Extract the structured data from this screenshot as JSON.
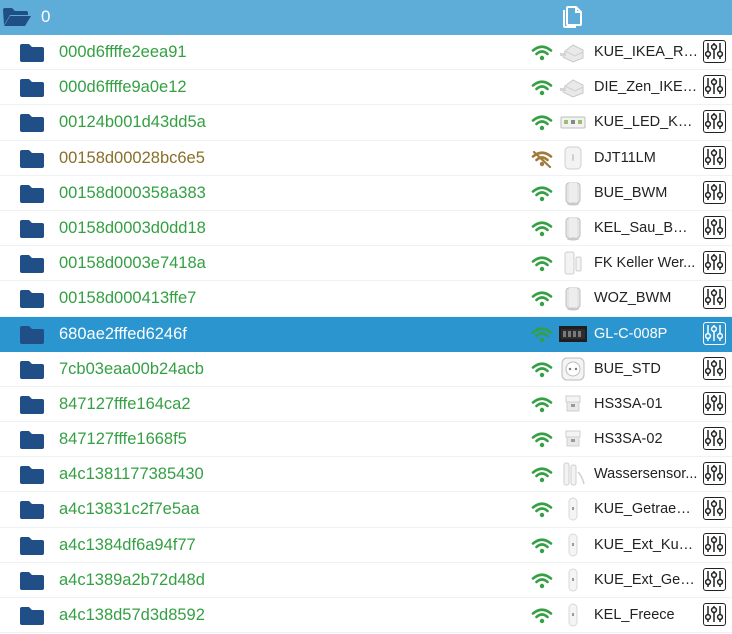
{
  "header": {
    "root_label": "0"
  },
  "colors": {
    "header_bg": "#5dadd8",
    "selected_bg": "#2b95cf",
    "name_green": "#34a043",
    "name_brown": "#8a6f2a",
    "folder_blue": "#1f4f86",
    "wifi_green": "#34a043"
  },
  "devices": [
    {
      "id": "000d6ffffe2eea91",
      "name": "KUE_IKEA_Re...",
      "signal": "ok",
      "thumb": "plug"
    },
    {
      "id": "000d6ffffe9a0e12",
      "name": "DIE_Zen_IKEA...",
      "signal": "ok",
      "thumb": "plug"
    },
    {
      "id": "00124b001d43dd5a",
      "name": "KUE_LED_Koc...",
      "signal": "ok",
      "thumb": "ledstrip"
    },
    {
      "id": "00158d00028bc6e5",
      "name": "DJT11LM",
      "signal": "off",
      "thumb": "vibration"
    },
    {
      "id": "00158d000358a383",
      "name": "BUE_BWM",
      "signal": "ok",
      "thumb": "motion"
    },
    {
      "id": "00158d0003d0dd18",
      "name": "KEL_Sau_BWM",
      "signal": "ok",
      "thumb": "motion"
    },
    {
      "id": "00158d0003e7418a",
      "name": "FK Keller Wer...",
      "signal": "ok",
      "thumb": "contact"
    },
    {
      "id": "00158d000413ffe7",
      "name": "WOZ_BWM",
      "signal": "ok",
      "thumb": "motion"
    },
    {
      "id": "680ae2fffed6246f",
      "name": "GL-C-008P",
      "signal": "ok",
      "thumb": "controller",
      "selected": true
    },
    {
      "id": "7cb03eaa00b24acb",
      "name": "BUE_STD",
      "signal": "ok",
      "thumb": "socket"
    },
    {
      "id": "847127fffe164ca2",
      "name": "HS3SA-01",
      "signal": "ok",
      "thumb": "smoke"
    },
    {
      "id": "847127fffe1668f5",
      "name": "HS3SA-02",
      "signal": "ok",
      "thumb": "smoke"
    },
    {
      "id": "a4c1381177385430",
      "name": "Wassersensor...",
      "signal": "ok",
      "thumb": "water"
    },
    {
      "id": "a4c13831c2f7e5aa",
      "name": "KUE_Getraenk...",
      "signal": "ok",
      "thumb": "thermo"
    },
    {
      "id": "a4c1384df6a94f77",
      "name": "KUE_Ext_Kueh...",
      "signal": "ok",
      "thumb": "thermo"
    },
    {
      "id": "a4c1389a2b72d48d",
      "name": "KUE_Ext_Gefri...",
      "signal": "ok",
      "thumb": "thermo"
    },
    {
      "id": "a4c138d57d3d8592",
      "name": "KEL_Freece",
      "signal": "ok",
      "thumb": "thermo"
    }
  ]
}
